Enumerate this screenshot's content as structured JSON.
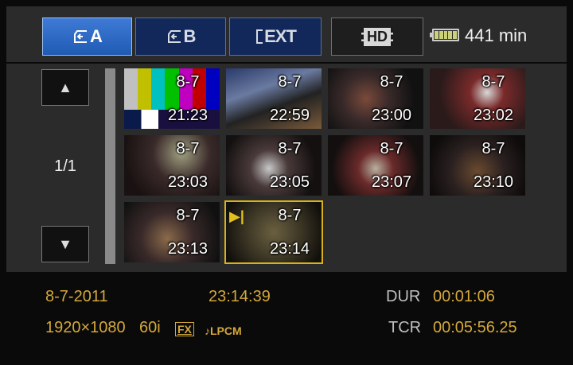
{
  "tabs": [
    {
      "label": "A",
      "icon": "card-slot-a-icon"
    },
    {
      "label": "B",
      "icon": "card-slot-b-icon"
    },
    {
      "label": "EXT",
      "icon": "external-drive-icon"
    },
    {
      "label": "HD",
      "icon": "hd-film-icon"
    }
  ],
  "status": {
    "remaining": "441 min",
    "battery_icon": "battery-icon"
  },
  "nav": {
    "up": "▲",
    "down": "▼",
    "page": "1/1"
  },
  "thumbnails": [
    {
      "date": "8-7",
      "time": "21:23"
    },
    {
      "date": "8-7",
      "time": "22:59"
    },
    {
      "date": "8-7",
      "time": "23:00"
    },
    {
      "date": "8-7",
      "time": "23:02"
    },
    {
      "date": "8-7",
      "time": "23:03"
    },
    {
      "date": "8-7",
      "time": "23:05"
    },
    {
      "date": "8-7",
      "time": "23:07"
    },
    {
      "date": "8-7",
      "time": "23:10"
    },
    {
      "date": "8-7",
      "time": "23:13"
    },
    {
      "date": "8-7",
      "time": "23:14"
    }
  ],
  "selected_index": 9,
  "info": {
    "date": "8-7-2011",
    "time": "23:14:39",
    "dur_label": "DUR",
    "dur_value": "00:01:06",
    "resolution": "1920×1080",
    "frame_rate": "60i",
    "mode": "FX",
    "audio": "♪LPCM",
    "tcr_label": "TCR",
    "tcr_value": "00:05:56.25"
  },
  "colors": {
    "accent": "#d4a83a",
    "selected_border": "#d8b21a",
    "tab_active": "#2c6ac8"
  }
}
